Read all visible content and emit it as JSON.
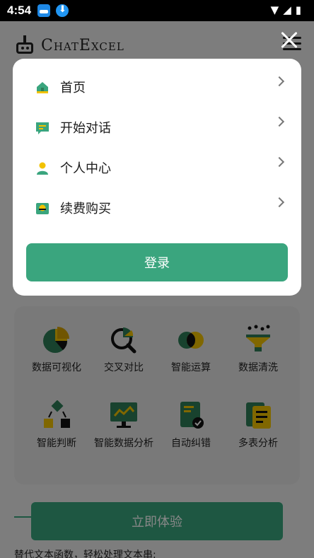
{
  "status_bar": {
    "time": "4:54",
    "icons": [
      "notification-app-icon",
      "download-icon",
      "wifi-icon",
      "signal-icon",
      "battery-icon"
    ]
  },
  "header": {
    "brand": "ChatExcel",
    "menu_icon": "hamburger-icon",
    "close_icon": "close-icon"
  },
  "menu": {
    "items": [
      {
        "label": "首页",
        "icon": "home-icon"
      },
      {
        "label": "开始对话",
        "icon": "chat-icon"
      },
      {
        "label": "个人中心",
        "icon": "user-icon"
      },
      {
        "label": "续费购买",
        "icon": "wallet-icon"
      }
    ],
    "login_label": "登录"
  },
  "features": {
    "items": [
      {
        "label": "数据可视化",
        "icon": "pie-chart-icon"
      },
      {
        "label": "交叉对比",
        "icon": "magnify-chart-icon"
      },
      {
        "label": "智能运算",
        "icon": "circles-icon"
      },
      {
        "label": "数据清洗",
        "icon": "filter-funnel-icon"
      },
      {
        "label": "智能判断",
        "icon": "decision-tree-icon"
      },
      {
        "label": "智能数据分析",
        "icon": "monitor-chart-icon"
      },
      {
        "label": "自动纠错",
        "icon": "document-check-icon"
      },
      {
        "label": "多表分析",
        "icon": "multi-sheet-icon"
      }
    ]
  },
  "cta_label": "立即体验",
  "footer_text": "替代文本函数，轻松处理文本串;",
  "colors": {
    "primary_green": "#3aa57e",
    "accent_yellow": "#f2c200",
    "dark_green": "#2e7d57",
    "overlay": "rgba(0,0,0,0.47)"
  }
}
